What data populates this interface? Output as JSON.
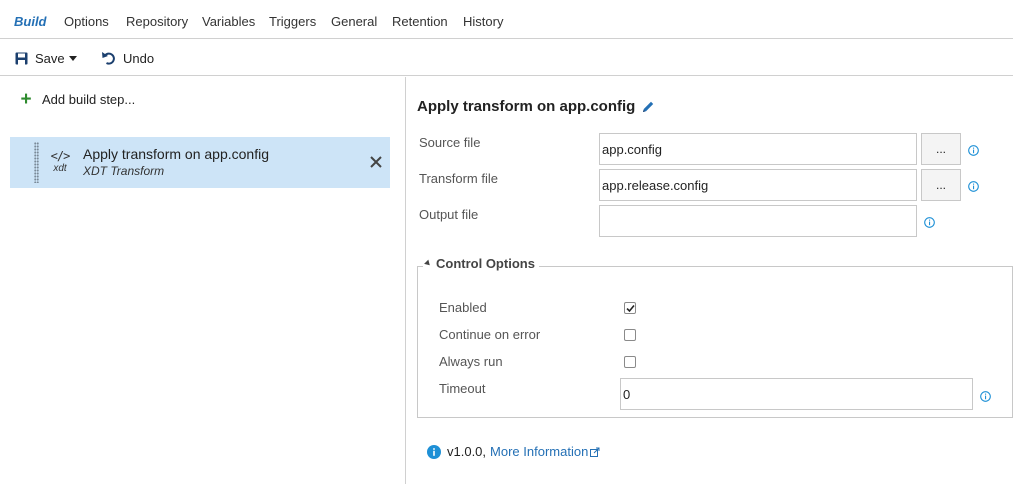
{
  "tabs": [
    {
      "label": "Build",
      "active": true
    },
    {
      "label": "Options"
    },
    {
      "label": "Repository"
    },
    {
      "label": "Variables"
    },
    {
      "label": "Triggers"
    },
    {
      "label": "General"
    },
    {
      "label": "Retention"
    },
    {
      "label": "History"
    }
  ],
  "toolbar": {
    "save_label": "Save",
    "undo_label": "Undo"
  },
  "left": {
    "add_step_label": "Add build step...",
    "steps": [
      {
        "title": "Apply transform on app.config",
        "subtitle": "XDT Transform",
        "icon_code": "</>",
        "icon_tag": "xdt",
        "selected": true
      }
    ]
  },
  "detail": {
    "title": "Apply transform on app.config",
    "fields": {
      "source": {
        "label": "Source file",
        "value": "app.config",
        "browse": "..."
      },
      "transform": {
        "label": "Transform file",
        "value": "app.release.config",
        "browse": "..."
      },
      "output": {
        "label": "Output file",
        "value": ""
      }
    },
    "control_options": {
      "title": "Control Options",
      "enabled": {
        "label": "Enabled",
        "checked": true
      },
      "continue_on_error": {
        "label": "Continue on error",
        "checked": false
      },
      "always_run": {
        "label": "Always run",
        "checked": false
      },
      "timeout": {
        "label": "Timeout",
        "value": "0"
      }
    },
    "footer": {
      "version": "v1.0.0,",
      "more_info": "More Information"
    }
  },
  "colors": {
    "accent": "#2470b5",
    "selected_row": "#cde4f7",
    "add_icon": "#2e8b2e",
    "info_icon": "#1e90d6"
  }
}
